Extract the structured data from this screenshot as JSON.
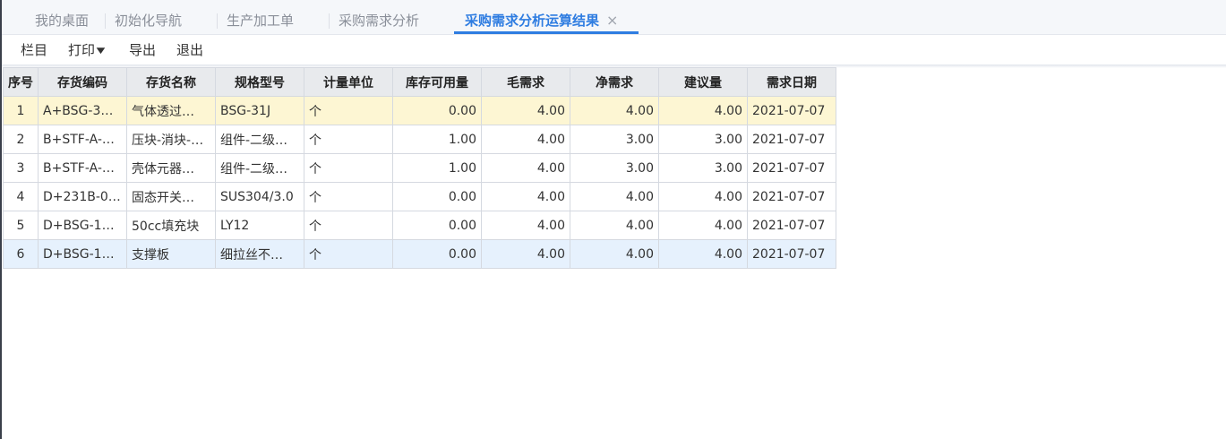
{
  "tabs": [
    {
      "label": "我的桌面"
    },
    {
      "label": "初始化导航"
    },
    {
      "label": "生产加工单"
    },
    {
      "label": "采购需求分析"
    },
    {
      "label": "采购需求分析运算结果",
      "close": "×"
    }
  ],
  "toolbar": {
    "columns_label": "栏目",
    "print_label": "打印",
    "export_label": "导出",
    "exit_label": "退出"
  },
  "table": {
    "headers": [
      "序号",
      "存货编码",
      "存货名称",
      "规格型号",
      "计量单位",
      "库存可用量",
      "毛需求",
      "净需求",
      "建议量",
      "需求日期"
    ],
    "rows": [
      {
        "seq": "1",
        "code": "A+BSG-3…",
        "name": "气体透过…",
        "spec": "BSG-31J",
        "unit": "个",
        "stock": "0.00",
        "gross": "4.00",
        "net": "4.00",
        "suggest": "4.00",
        "date": "2021-07-07"
      },
      {
        "seq": "2",
        "code": "B+STF-A-…",
        "name": "压块-消块-…",
        "spec": "组件-二级…",
        "unit": "个",
        "stock": "1.00",
        "gross": "4.00",
        "net": "3.00",
        "suggest": "3.00",
        "date": "2021-07-07"
      },
      {
        "seq": "3",
        "code": "B+STF-A-…",
        "name": "壳体元器…",
        "spec": "组件-二级…",
        "unit": "个",
        "stock": "1.00",
        "gross": "4.00",
        "net": "3.00",
        "suggest": "3.00",
        "date": "2021-07-07"
      },
      {
        "seq": "4",
        "code": "D+231B-0…",
        "name": "固态开关…",
        "spec": "SUS304/3.0",
        "unit": "个",
        "stock": "0.00",
        "gross": "4.00",
        "net": "4.00",
        "suggest": "4.00",
        "date": "2021-07-07"
      },
      {
        "seq": "5",
        "code": "D+BSG-1…",
        "name": "50cc填充块",
        "spec": "LY12",
        "unit": "个",
        "stock": "0.00",
        "gross": "4.00",
        "net": "4.00",
        "suggest": "4.00",
        "date": "2021-07-07"
      },
      {
        "seq": "6",
        "code": "D+BSG-1…",
        "name": "支撑板",
        "spec": "细拉丝不…",
        "unit": "个",
        "stock": "0.00",
        "gross": "4.00",
        "net": "4.00",
        "suggest": "4.00",
        "date": "2021-07-07"
      }
    ]
  },
  "colors": {
    "accent": "#2f7de1",
    "selected_row": "#fdf6d3",
    "hover_row": "#e6f1fd",
    "header_bg": "#e8eaed"
  }
}
